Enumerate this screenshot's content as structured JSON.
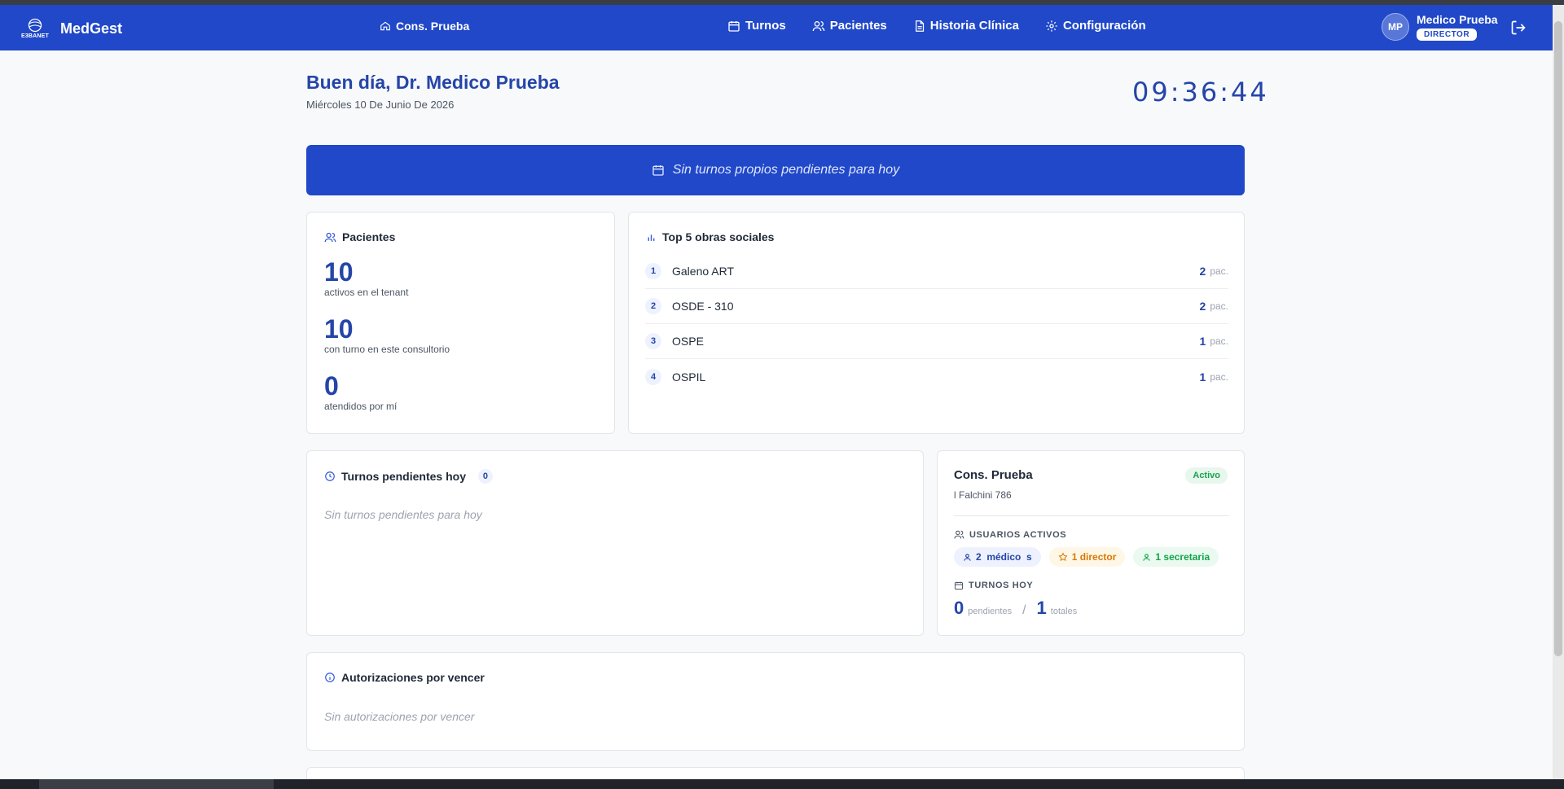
{
  "navbar": {
    "logo_text": "E3BANET",
    "brand": "MedGest",
    "clinic": "Cons. Prueba",
    "items": [
      {
        "label": "Turnos"
      },
      {
        "label": "Pacientes"
      },
      {
        "label": "Historia Clínica"
      },
      {
        "label": "Configuración"
      }
    ],
    "user": {
      "initials": "MP",
      "name": "Medico Prueba",
      "role": "DIRECTOR"
    }
  },
  "header": {
    "greeting": "Buen día, Dr. Medico Prueba",
    "date": "Miércoles 10 De Junio De 2026",
    "clock": "09:36:44"
  },
  "banner": {
    "text": "Sin turnos propios pendientes para hoy"
  },
  "patients": {
    "title": "Pacientes",
    "stats": [
      {
        "value": "10",
        "label": "activos en el tenant"
      },
      {
        "value": "10",
        "label": "con turno en este consultorio"
      },
      {
        "value": "0",
        "label": "atendidos por mí"
      }
    ]
  },
  "top_os": {
    "title": "Top 5 obras sociales",
    "unit": "pac.",
    "items": [
      {
        "rank": "1",
        "name": "Galeno ART",
        "count": "2"
      },
      {
        "rank": "2",
        "name": "OSDE - 310",
        "count": "2"
      },
      {
        "rank": "3",
        "name": "OSPE",
        "count": "1"
      },
      {
        "rank": "4",
        "name": "OSPIL",
        "count": "1"
      }
    ]
  },
  "pending": {
    "title": "Turnos pendientes hoy",
    "count": "0",
    "empty": "Sin turnos pendientes para hoy"
  },
  "clinic_card": {
    "name": "Cons. Prueba",
    "address": "l Falchini 786",
    "status": "Activo",
    "users_label": "USUARIOS ACTIVOS",
    "chips": [
      {
        "text": "2  médico  s",
        "color": "#2545a8"
      },
      {
        "text": "1 director",
        "color": "#d97706"
      },
      {
        "text": "1 secretaria",
        "color": "#16a34a"
      }
    ],
    "turnos_label": "TURNOS HOY",
    "pending_value": "0",
    "pending_label": "pendientes",
    "separator": "/",
    "total_value": "1",
    "total_label": "totales"
  },
  "authorizations": {
    "title": "Autorizaciones por vencer",
    "empty": "Sin autorizaciones por vencer"
  },
  "colors": {
    "primary": "#2048c8",
    "accent": "#2545a8",
    "success": "#16a34a",
    "warning": "#d97706"
  },
  "icons": [
    "home-icon",
    "calendar-icon",
    "users-icon",
    "file-icon",
    "gear-icon",
    "logout-icon",
    "bar-chart-icon",
    "clock-icon",
    "info-icon",
    "user-icon",
    "star-icon"
  ]
}
